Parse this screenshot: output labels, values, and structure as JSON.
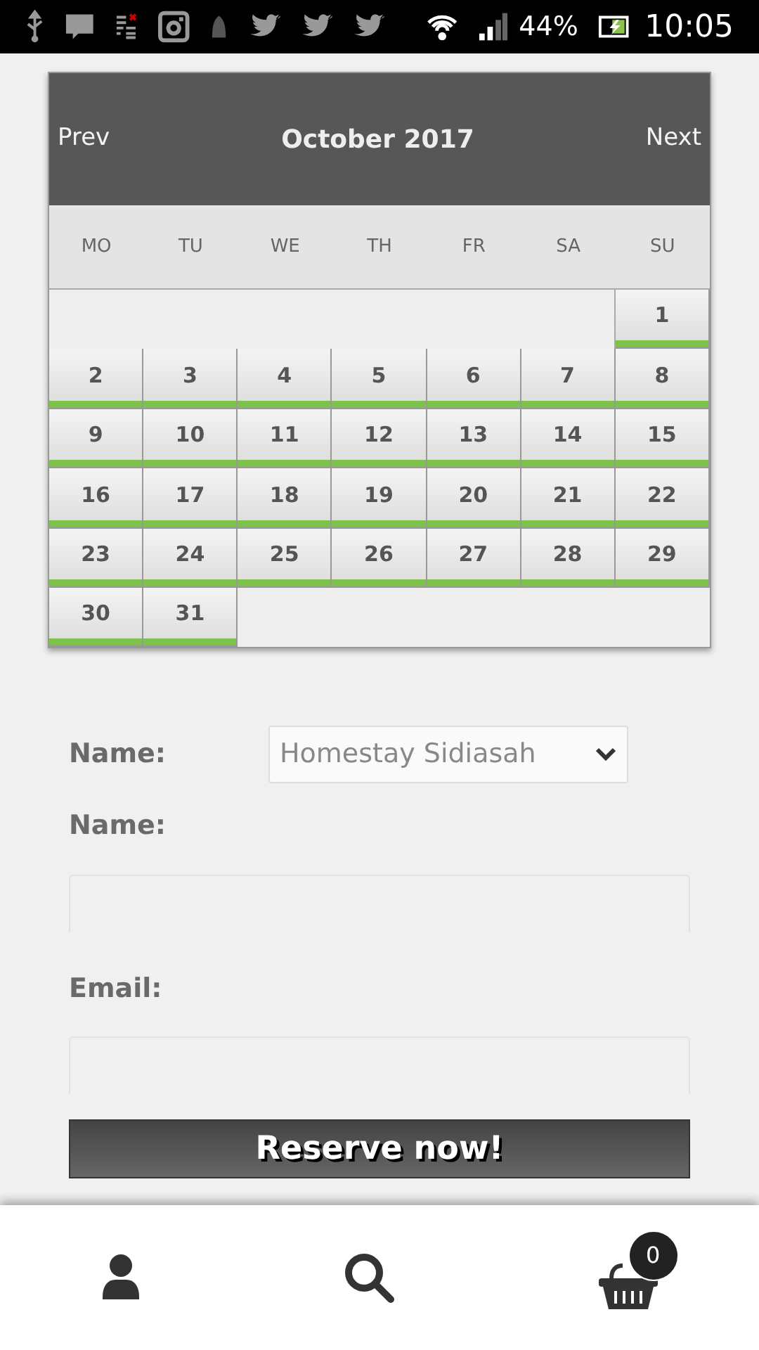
{
  "status_bar": {
    "battery": "44%",
    "time": "10:05"
  },
  "calendar": {
    "prev": "Prev",
    "title": "October 2017",
    "next": "Next",
    "weekdays": [
      "MO",
      "TU",
      "WE",
      "TH",
      "FR",
      "SA",
      "SU"
    ],
    "weeks": [
      [
        {
          "day": "1",
          "available": true
        }
      ],
      [
        {
          "day": "2",
          "available": true
        },
        {
          "day": "3",
          "available": true
        },
        {
          "day": "4",
          "available": true
        },
        {
          "day": "5",
          "available": true
        },
        {
          "day": "6",
          "available": true
        },
        {
          "day": "7",
          "available": true
        },
        {
          "day": "8",
          "available": true
        }
      ],
      [
        {
          "day": "9",
          "available": true
        },
        {
          "day": "10",
          "available": true
        },
        {
          "day": "11",
          "available": true
        },
        {
          "day": "12",
          "available": true
        },
        {
          "day": "13",
          "available": true
        },
        {
          "day": "14",
          "available": true
        },
        {
          "day": "15",
          "available": true
        }
      ],
      [
        {
          "day": "16",
          "available": true
        },
        {
          "day": "17",
          "available": true
        },
        {
          "day": "18",
          "available": true
        },
        {
          "day": "19",
          "available": true
        },
        {
          "day": "20",
          "available": true
        },
        {
          "day": "21",
          "available": true
        },
        {
          "day": "22",
          "available": true
        }
      ],
      [
        {
          "day": "23",
          "available": true
        },
        {
          "day": "24",
          "available": true
        },
        {
          "day": "25",
          "available": true
        },
        {
          "day": "26",
          "available": true
        },
        {
          "day": "27",
          "available": true
        },
        {
          "day": "28",
          "available": true
        },
        {
          "day": "29",
          "available": true
        }
      ],
      [
        {
          "day": "30",
          "available": true
        },
        {
          "day": "31",
          "available": true
        }
      ]
    ]
  },
  "form": {
    "property_label": "Name:",
    "property_value": "Homestay Sidiasah",
    "name_label": "Name:",
    "email_label": "Email:",
    "submit": "Reserve now!"
  },
  "bottom_nav": {
    "cart_count": "0"
  }
}
